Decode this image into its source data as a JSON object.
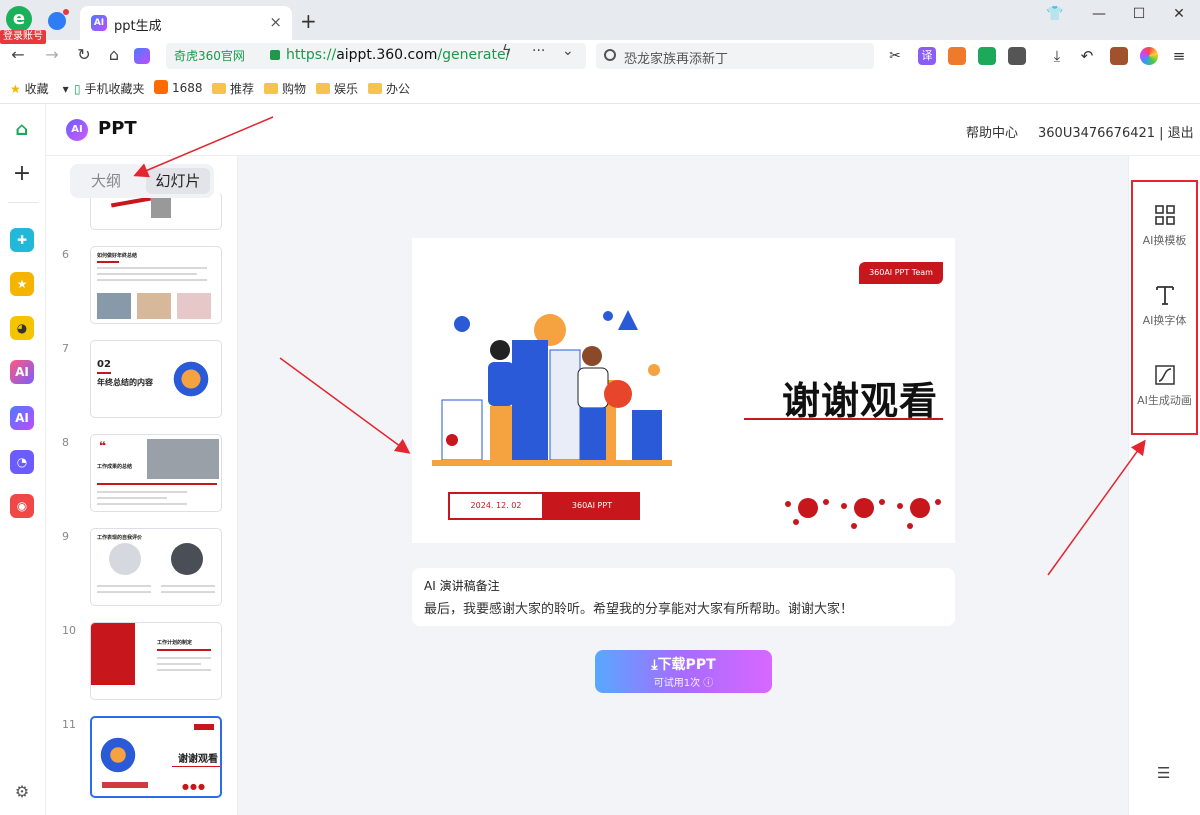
{
  "browser": {
    "login_badge": "登录账号",
    "tab_title": "ppt生成",
    "tab_close": "×",
    "new_tab": "+",
    "favicon_text": "AI",
    "site_tag": "奇虎360官网",
    "url_scheme": "https://",
    "url_host": "aippt.360.com",
    "url_path": "/generate/",
    "search_text": "恐龙家族再添新丁",
    "ext_translate": "译"
  },
  "bookmarks": [
    {
      "label": "收藏"
    },
    {
      "label": "手机收藏夹"
    },
    {
      "label": "1688"
    },
    {
      "label": "推荐"
    },
    {
      "label": "购物"
    },
    {
      "label": "娱乐"
    },
    {
      "label": "办公"
    }
  ],
  "header": {
    "logo_text": "AI",
    "title": "PPT",
    "help": "帮助中心",
    "user": "360U3476676421 | 退出"
  },
  "sidebar_toggle": {
    "outline": "大纲",
    "slides": "幻灯片"
  },
  "thumbnails": [
    {
      "num": "6",
      "title": "如何做好年终总结"
    },
    {
      "num": "7",
      "title": "年终总结的内容",
      "index": "02"
    },
    {
      "num": "8",
      "title": "工作成果的总结"
    },
    {
      "num": "9",
      "title": "工作表现的自我评价"
    },
    {
      "num": "10",
      "title": "工作计划的制定"
    },
    {
      "num": "11",
      "title": "谢谢观看"
    }
  ],
  "slide": {
    "badge": "360AI PPT Team",
    "thanks": "谢谢观看",
    "date": "2024. 12. 02",
    "brand": "360AI PPT"
  },
  "notes": {
    "title": "AI 演讲稿备注",
    "text": "最后，我要感谢大家的聆听。希望我的分享能对大家有所帮助。谢谢大家！"
  },
  "download": {
    "label": "下载PPT",
    "sub": "可试用1次"
  },
  "tools": [
    {
      "label": "AI换模板",
      "icon": "grid-icon"
    },
    {
      "label": "AI换字体",
      "icon": "font-icon"
    },
    {
      "label": "AI生成动画",
      "icon": "animation-icon"
    }
  ],
  "colors": {
    "accent_red": "#c8161d",
    "annotation_red": "#e3262f",
    "selected_blue": "#2a6cf0"
  }
}
